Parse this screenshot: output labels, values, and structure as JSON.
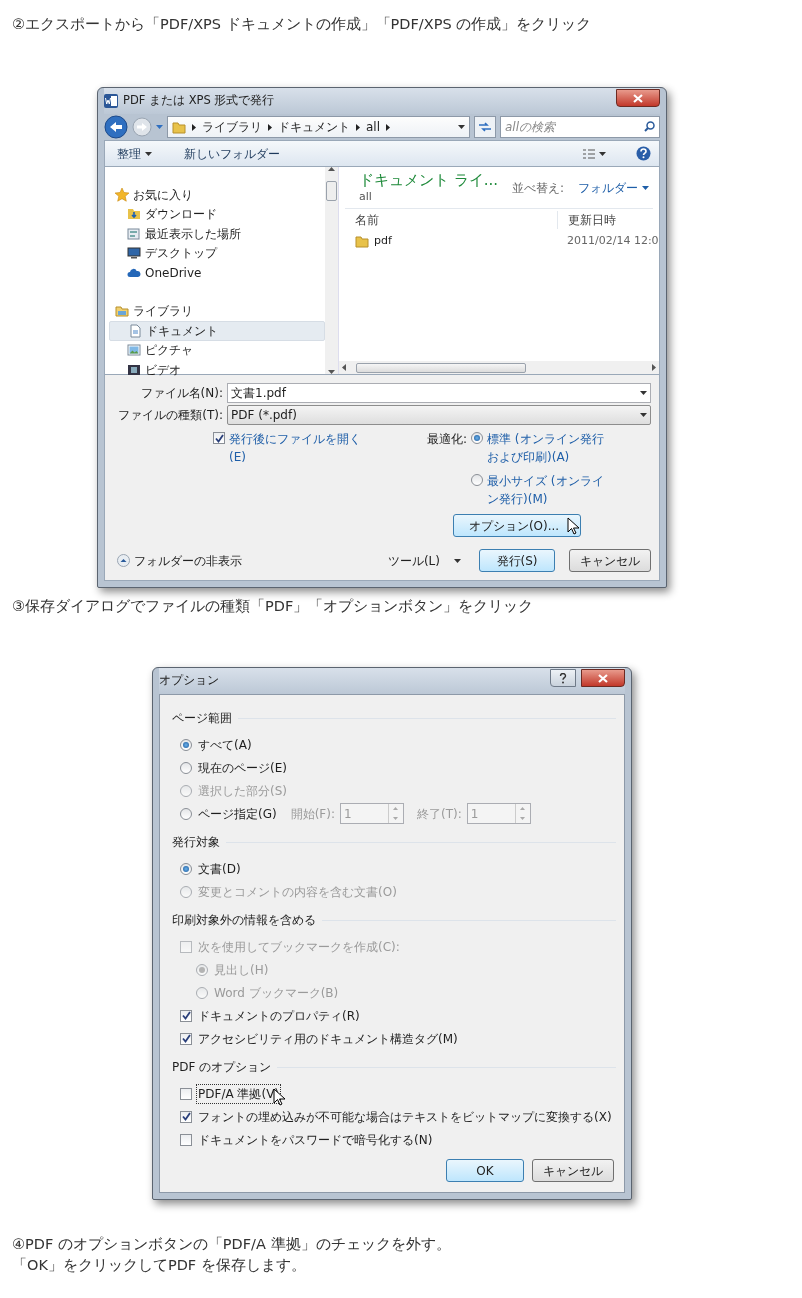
{
  "step_2": "②エクスポートから「PDF/XPS ドキュメントの作成」「PDF/XPS の作成」をクリック",
  "save_dialog": {
    "title": "PDF または XPS 形式で発行",
    "path": [
      "ライブラリ",
      "ドキュメント",
      "all"
    ],
    "search": {
      "placeholder": "allの検索"
    },
    "toolbar": [
      "整理",
      "新しいフォルダー"
    ],
    "nav_tree": [
      {
        "label": "お気に入り",
        "kind": "star",
        "selected": false,
        "children": [
          {
            "label": "ダウンロード",
            "kind": "download",
            "selected": false
          },
          {
            "label": "最近表示した場所",
            "kind": "recent",
            "selected": false
          },
          {
            "label": "デスクトップ",
            "kind": "desktop",
            "selected": false
          },
          {
            "label": "OneDrive",
            "kind": "cloud",
            "selected": false
          }
        ]
      },
      {
        "label": "ライブラリ",
        "kind": "library",
        "selected": false,
        "children": [
          {
            "label": "ドキュメント",
            "kind": "document",
            "selected": true
          },
          {
            "label": "ピクチャ",
            "kind": "picture",
            "selected": false
          },
          {
            "label": "ビデオ",
            "kind": "video",
            "selected": false
          }
        ]
      }
    ],
    "library_title": "ドキュメント ライ...",
    "library_subtitle": "all",
    "sort_label": "並べ替え:",
    "sort_value": "フォルダー",
    "columns": [
      "名前",
      "更新日時"
    ],
    "rows": [
      {
        "name": "pdf",
        "modified": "2011/02/14 12:0"
      }
    ],
    "file_name": {
      "label": "ファイル名(N):",
      "value": "文書1.pdf"
    },
    "file_type": {
      "label": "ファイルの種類(T):",
      "value": "PDF (*.pdf)"
    },
    "open_after": {
      "label": "発行後にファイルを開く(E)",
      "checked": true
    },
    "optimize": {
      "label": "最適化:",
      "options": [
        {
          "label": "標準 (オンライン発行および印刷)(A)",
          "selected": true
        },
        {
          "label": "最小サイズ (オンライン発行)(M)",
          "selected": false
        }
      ]
    },
    "options_button": "オプション(O)...",
    "hide_folders": "フォルダーの非表示",
    "tools": "ツール(L)",
    "buttons": [
      {
        "label": "発行(S)",
        "default": true
      },
      {
        "label": "キャンセル",
        "default": false
      }
    ]
  },
  "step_3": "③保存ダイアログでファイルの種類「PDF」「オプションボタン」をクリック",
  "options_dialog": {
    "title": "オプション",
    "groups": [
      {
        "title": "ページ範囲",
        "items": [
          {
            "kind": "radio",
            "label": "すべて(A)",
            "selected": true,
            "disabled": false
          },
          {
            "kind": "radio",
            "label": "現在のページ(E)",
            "selected": false,
            "disabled": false
          },
          {
            "kind": "radio",
            "label": "選択した部分(S)",
            "selected": false,
            "disabled": true
          },
          {
            "kind": "radio_range",
            "label": "ページ指定(G)",
            "selected": false,
            "disabled": false,
            "from_label": "開始(F):",
            "from_value": "1",
            "to_label": "終了(T):",
            "to_value": "1"
          }
        ]
      },
      {
        "title": "発行対象",
        "items": [
          {
            "kind": "radio",
            "label": "文書(D)",
            "selected": true,
            "disabled": false
          },
          {
            "kind": "radio",
            "label": "変更とコメントの内容を含む文書(O)",
            "selected": false,
            "disabled": true
          }
        ]
      },
      {
        "title": "印刷対象外の情報を含める",
        "items": [
          {
            "kind": "checkbox",
            "label": "次を使用してブックマークを作成(C):",
            "checked": false,
            "disabled": true,
            "children": [
              {
                "kind": "radio",
                "label": "見出し(H)",
                "selected": true,
                "disabled": true
              },
              {
                "kind": "radio",
                "label": "Word ブックマーク(B)",
                "selected": false,
                "disabled": true
              }
            ]
          },
          {
            "kind": "checkbox",
            "label": "ドキュメントのプロパティ(R)",
            "checked": true,
            "disabled": false
          },
          {
            "kind": "checkbox",
            "label": "アクセシビリティ用のドキュメント構造タグ(M)",
            "checked": true,
            "disabled": false
          }
        ]
      },
      {
        "title": "PDF のオプション",
        "items": [
          {
            "kind": "checkbox",
            "label": "PDF/A 準拠(V)",
            "checked": false,
            "disabled": false,
            "focused": true
          },
          {
            "kind": "checkbox",
            "label": "フォントの埋め込みが不可能な場合はテキストをビットマップに変換する(X)",
            "checked": true,
            "disabled": false,
            "focused": false
          },
          {
            "kind": "checkbox",
            "label": "ドキュメントをパスワードで暗号化する(N)",
            "checked": false,
            "disabled": false,
            "focused": false
          }
        ]
      }
    ],
    "buttons": [
      {
        "label": "OK",
        "default": true
      },
      {
        "label": "キャンセル",
        "default": false
      }
    ]
  },
  "step_4": [
    "④PDF のオプションボタンの「PDF/A 準拠」のチェックを外す。",
    "「OK」をクリックしてPDF を保存します。"
  ]
}
